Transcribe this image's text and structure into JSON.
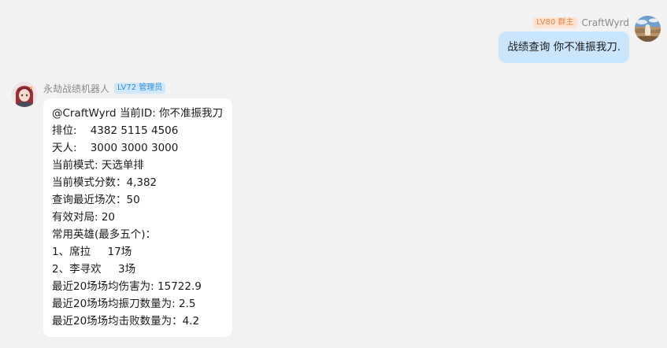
{
  "outgoing": {
    "badge": "LV80 群主",
    "sender": "CraftWyrd",
    "text": "战绩查询 你不准振我刀."
  },
  "incoming": {
    "sender": "永劫战绩机器人",
    "badge": "LV72 管理员",
    "lines": [
      "@CraftWyrd 当前ID: 你不准振我刀",
      "排位:    4382 5115 4506",
      "天人:    3000 3000 3000",
      "当前模式: 天选单排",
      "当前模式分数：4,382",
      "查询最近场次：50",
      "有效对局: 20",
      "常用英雄(最多五个)：",
      "1、席拉     17场",
      "2、李寻欢     3场",
      "最近20场场均伤害为: 15722.9",
      "最近20场场均振刀数量为: 2.5",
      "最近20场场均击败数量为：4.2"
    ]
  },
  "colors": {
    "background": "#f2f2f2",
    "outgoing_bubble": "#c9e6fd",
    "incoming_bubble": "#ffffff",
    "owner_badge_bg": "#fde2cf",
    "owner_badge_text": "#e8864a",
    "admin_badge_bg": "#cfe8fb",
    "admin_badge_text": "#2f8fd8"
  }
}
